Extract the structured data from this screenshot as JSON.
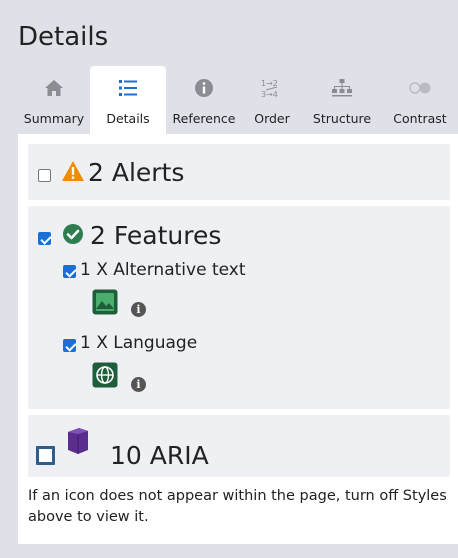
{
  "header": {
    "title": "Details"
  },
  "tabs": [
    {
      "label": "Summary",
      "icon": "home-icon",
      "active": false
    },
    {
      "label": "Details",
      "icon": "list-icon",
      "active": true
    },
    {
      "label": "Reference",
      "icon": "info-icon",
      "active": false
    },
    {
      "label": "Order",
      "icon": "order-icon",
      "active": false
    },
    {
      "label": "Structure",
      "icon": "structure-icon",
      "active": false
    },
    {
      "label": "Contrast",
      "icon": "contrast-icon",
      "active": false
    }
  ],
  "alerts": {
    "label": "2 Alerts",
    "checked": false,
    "icon": "warning-icon",
    "icon_color": "#f08c00"
  },
  "features": {
    "label": "2 Features",
    "checked": true,
    "icon": "check-circle-icon",
    "icon_color": "#2e7d4f",
    "items": [
      {
        "label": "1 X Alternative text",
        "checked": true,
        "icon": "image-icon"
      },
      {
        "label": "1 X Language",
        "checked": true,
        "icon": "globe-icon"
      }
    ]
  },
  "aria": {
    "label": "10 ARIA",
    "checked": false,
    "icon": "aria-cube-icon",
    "icon_color": "#5b2d8e"
  },
  "footnote": "If an icon does not appear within the page, turn off Styles above to view it.",
  "colors": {
    "accent": "#1a6fd6",
    "feature_green": "#1e5e3a",
    "aria_purple": "#5b2d8e"
  }
}
